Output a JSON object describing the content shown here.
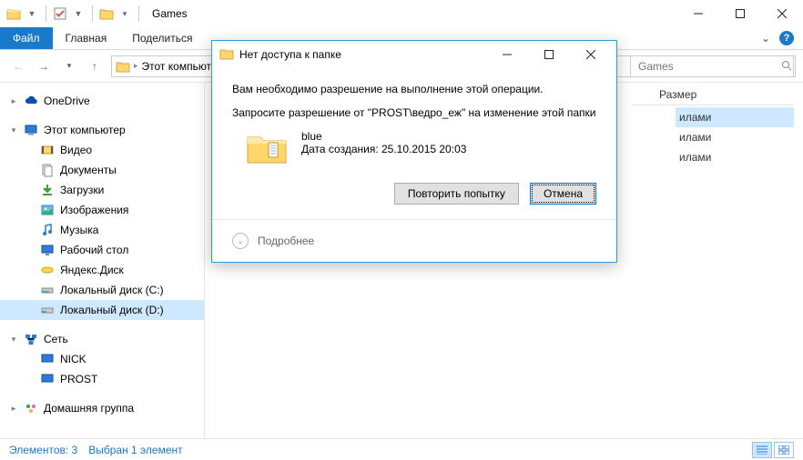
{
  "window_title": "Games",
  "ribbon": {
    "file": "Файл",
    "home": "Главная",
    "share": "Поделиться"
  },
  "nav": {
    "back": "←",
    "fwd": "→",
    "up": "↑"
  },
  "address": {
    "seg0": "Этот компьют"
  },
  "search": {
    "placeholder": "Games"
  },
  "columns": {
    "size": "Размер"
  },
  "frag": {
    "r1": "илами",
    "r2": "илами",
    "r3": "илами"
  },
  "tree": {
    "onedrive": "OneDrive",
    "thispc": "Этот компьютер",
    "video": "Видео",
    "docs": "Документы",
    "downloads": "Загрузки",
    "pictures": "Изображения",
    "music": "Музыка",
    "desktop": "Рабочий стол",
    "yandex": "Яндекс.Диск",
    "diskC": "Локальный диск (C:)",
    "diskD": "Локальный диск (D:)",
    "network": "Сеть",
    "nick": "NICK",
    "prost": "PROST",
    "homegroup": "Домашняя группа"
  },
  "status": {
    "count": "Элементов: 3",
    "sel": "Выбран 1 элемент"
  },
  "dialog": {
    "title": "Нет доступа к папке",
    "line1": "Вам необходимо разрешение на выполнение этой операции.",
    "line2": "Запросите разрешение от \"PROST\\ведро_еж\" на изменение этой папки",
    "folder_name": "blue",
    "folder_date_label": "Дата создания: 25.10.2015 20:03",
    "retry": "Повторить попытку",
    "cancel": "Отмена",
    "more": "Подробнее"
  }
}
